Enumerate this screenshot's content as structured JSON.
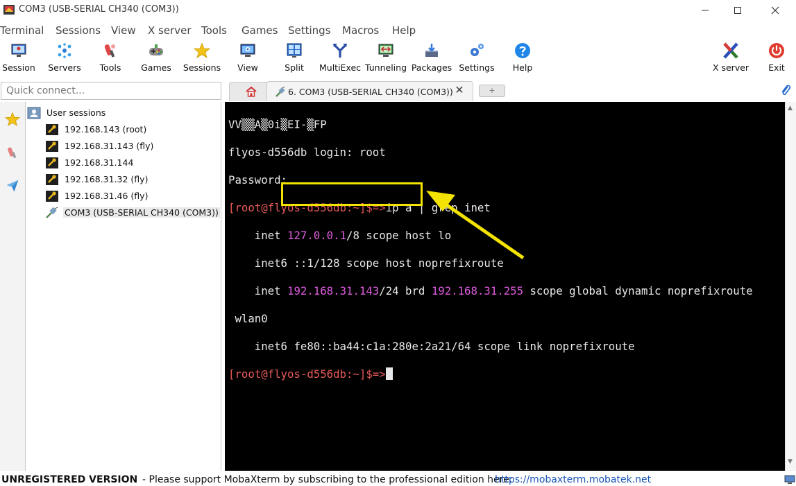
{
  "window": {
    "title": "COM3  (USB-SERIAL CH340 (COM3))",
    "minimize_icon": "minimize-icon",
    "maximize_icon": "maximize-icon",
    "close_icon": "close-icon"
  },
  "menu": [
    "Terminal",
    "Sessions",
    "View",
    "X server",
    "Tools",
    "Games",
    "Settings",
    "Macros",
    "Help"
  ],
  "toolbar": {
    "session": {
      "label": "Session",
      "icon": "session-monitor-icon"
    },
    "servers": {
      "label": "Servers",
      "icon": "servers-icon"
    },
    "tools": {
      "label": "Tools",
      "icon": "tools-icon"
    },
    "games": {
      "label": "Games",
      "icon": "gamepad-icon"
    },
    "sessions": {
      "label": "Sessions",
      "icon": "star-icon"
    },
    "view": {
      "label": "View",
      "icon": "view-monitor-icon"
    },
    "split": {
      "label": "Split",
      "icon": "split-icon"
    },
    "multiexec": {
      "label": "MultiExec",
      "icon": "multiexec-icon"
    },
    "tunneling": {
      "label": "Tunneling",
      "icon": "tunneling-icon"
    },
    "packages": {
      "label": "Packages",
      "icon": "packages-icon"
    },
    "settings": {
      "label": "Settings",
      "icon": "gears-icon"
    },
    "help": {
      "label": "Help",
      "icon": "help-icon"
    },
    "xserver": {
      "label": "X server",
      "icon": "x-server-icon"
    },
    "exit": {
      "label": "Exit",
      "icon": "power-icon"
    }
  },
  "quick_connect": {
    "placeholder": "Quick connect..."
  },
  "tabs": {
    "home_icon": "home-icon",
    "active_label": "6. COM3  (USB-SERIAL CH340 (COM3))",
    "active_icon": "serial-plug-icon",
    "close_label": "✕",
    "new_tab_label": "+"
  },
  "sidebar": {
    "strip": [
      "star-icon",
      "tools-icon",
      "paper-plane-icon"
    ],
    "root_label": "User sessions",
    "sessions": [
      {
        "label": "192.168.143 (root)",
        "icon": "ssh-key-icon"
      },
      {
        "label": "192.168.31.143 (fly)",
        "icon": "ssh-key-icon"
      },
      {
        "label": "192.168.31.144",
        "icon": "ssh-key-icon"
      },
      {
        "label": "192.168.31.32 (fly)",
        "icon": "ssh-key-icon"
      },
      {
        "label": "192.168.31.46 (fly)",
        "icon": "ssh-key-icon"
      },
      {
        "label": "COM3  (USB-SERIAL CH340 (COM3))",
        "icon": "serial-plug-icon"
      }
    ]
  },
  "terminal": {
    "line1": "VV▒▒A▒0i▒EI-▒FP",
    "line2": "flyos-d556db login: root",
    "line3": "Password:",
    "line4_prompt": "[root@flyos-d556db:~]$=>",
    "line4_cmd": "ip a | grep inet",
    "line5_pre": "    inet ",
    "line5_ip": "127.0.0.1",
    "line5_post": "/8 scope host lo",
    "line6": "    inet6 ::1/128 scope host noprefixroute",
    "line7_pre": "    inet ",
    "line7_ip": "192.168.31.143",
    "line7_mid": "/24 brd ",
    "line7_brd": "192.168.31.255",
    "line7_post": " scope global dynamic noprefixroute",
    "line8": " wlan0",
    "line9": "    inet6 fe80::ba44:c1a:280e:2a21/64 scope link noprefixroute",
    "line10_prompt": "[root@flyos-d556db:~]$=>"
  },
  "status": {
    "registration": "UNREGISTERED VERSION",
    "message": "-  Please support MobaXterm by subscribing to the professional edition here:",
    "link": "https://mobaxterm.mobatek.net"
  },
  "colors": {
    "terminal_bg": "#000000",
    "prompt": "#e85a5a",
    "ip_highlight": "#e05ce0",
    "annotation": "#f3e300",
    "link": "#1a55b8"
  }
}
